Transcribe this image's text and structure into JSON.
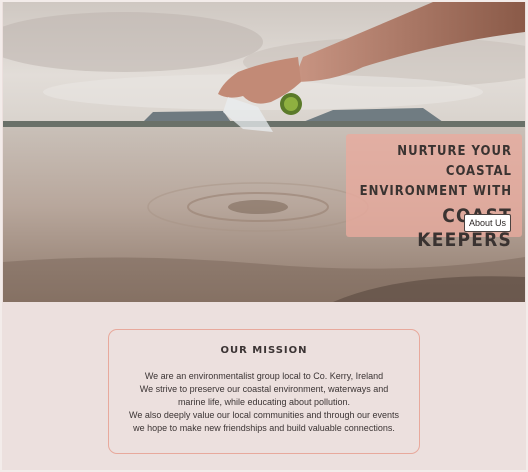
{
  "hero": {
    "headline_line1": "NURTURE YOUR COASTAL",
    "headline_line2": "ENVIRONMENT WITH",
    "brand": "COAST KEEPERS",
    "about_button": "About Us"
  },
  "mission": {
    "title": "OUR MISSION",
    "lines": [
      "We are an environmentalist group local to Co. Kerry, Ireland",
      "We strive to preserve our coastal environment, waterways and",
      "marine life, while educating about pollution.",
      "We also deeply value our local communities and through our events",
      "we hope to make new friendships and build valuable connections."
    ]
  },
  "colors": {
    "page_background": "#ece0de",
    "accent": "#e9aa9d",
    "text": "#3b3434"
  }
}
